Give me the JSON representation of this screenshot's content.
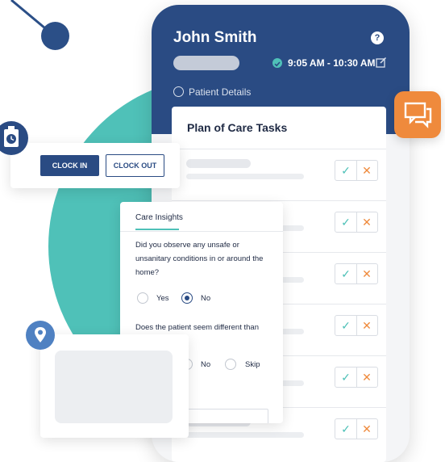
{
  "header": {
    "patient_name": "John Smith",
    "help_label": "?",
    "visit_time": "9:05 AM - 10:30 AM",
    "patient_details_label": "Patient Details"
  },
  "tasks": {
    "title": "Plan of Care Tasks",
    "approve_label": "✓",
    "reject_label": "✕",
    "rows": [
      1,
      2,
      3,
      4,
      5,
      6
    ]
  },
  "clock": {
    "clock_in_label": "CLOCK IN",
    "clock_out_label": "CLOCK OUT"
  },
  "insights": {
    "tab_label": "Care Insights",
    "q1": "Did you observe any unsafe or unsanitary  conditions in or around the home?",
    "q1_options": [
      {
        "label": "Yes",
        "selected": false
      },
      {
        "label": "No",
        "selected": true
      }
    ],
    "q2": "Does the patient seem different than",
    "q2_options": [
      {
        "label": "No",
        "selected": false
      },
      {
        "label": "Skip",
        "selected": false
      }
    ]
  },
  "colors": {
    "navy": "#2a4b83",
    "teal": "#4fc1b8",
    "orange": "#ef8a3c",
    "location_blue": "#4f81c2"
  },
  "icons": [
    "help-icon",
    "check-circle-icon",
    "edit-icon",
    "person-icon",
    "chat-icon",
    "clock-icon",
    "location-pin-icon"
  ]
}
